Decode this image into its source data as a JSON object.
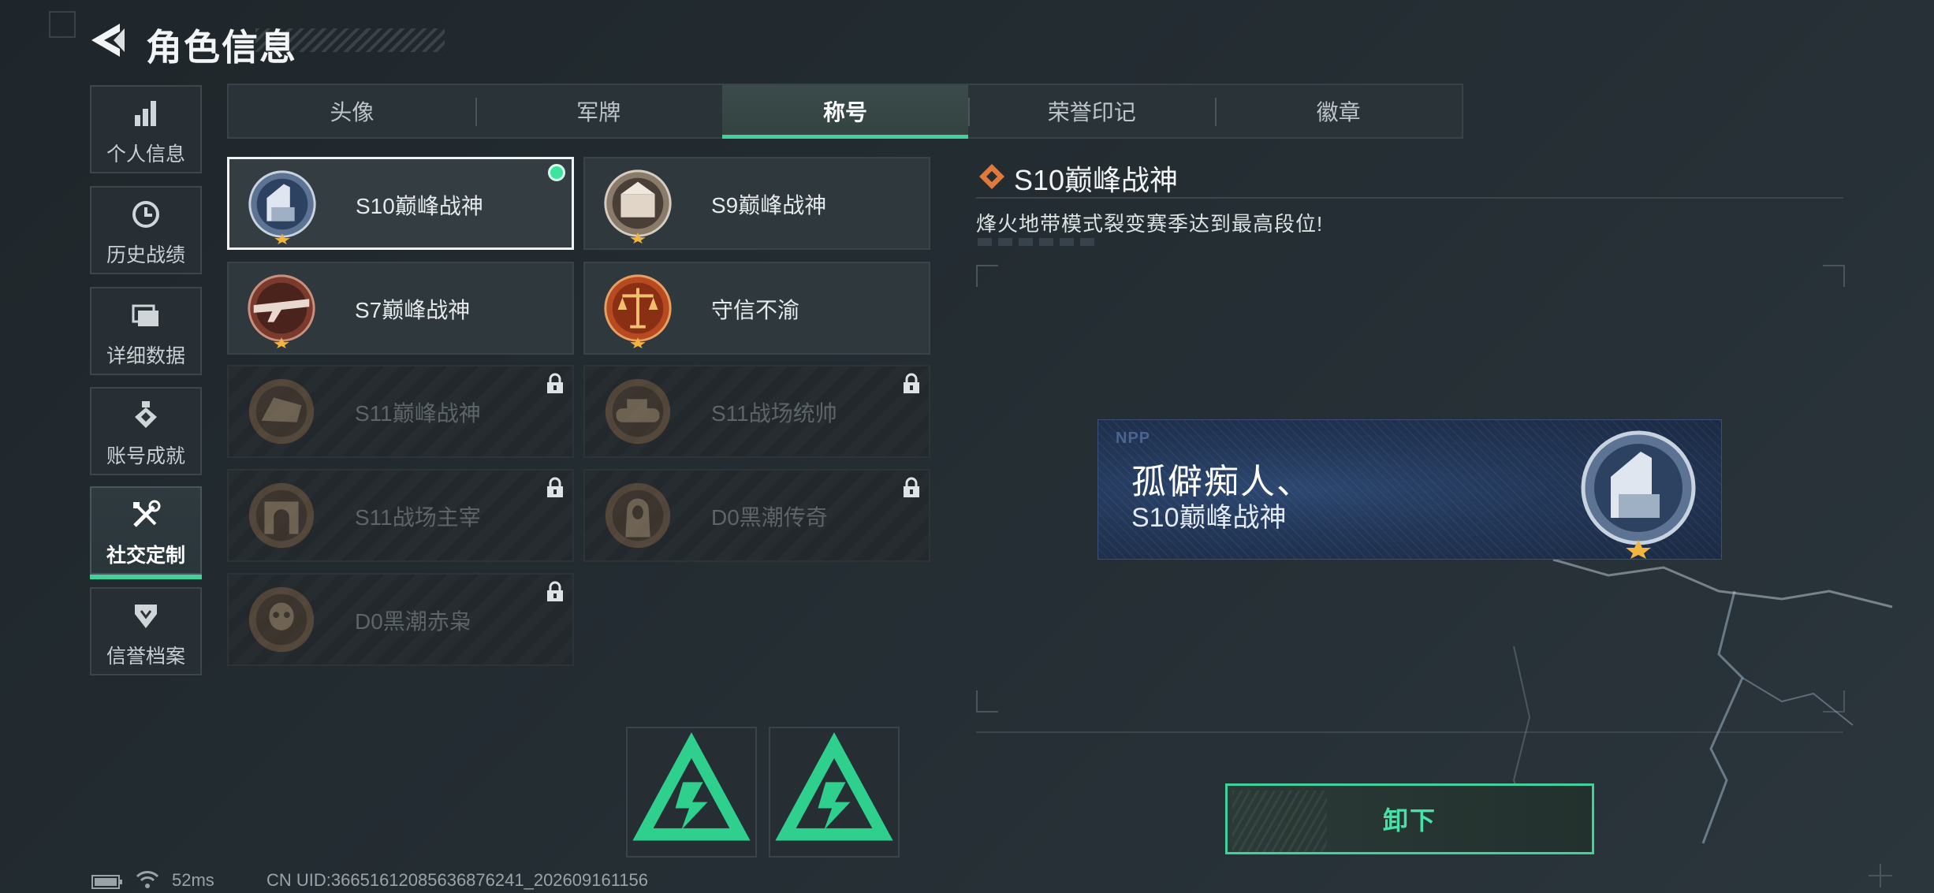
{
  "header": {
    "title": "角色信息"
  },
  "sidebar": {
    "items": [
      {
        "label": "个人信息",
        "icon": "bar-chart-icon"
      },
      {
        "label": "历史战绩",
        "icon": "history-clock-icon"
      },
      {
        "label": "详细数据",
        "icon": "folder-icon"
      },
      {
        "label": "账号成就",
        "icon": "achievement-medal-icon"
      },
      {
        "label": "社交定制",
        "icon": "tools-icon",
        "active": true
      },
      {
        "label": "信誉档案",
        "icon": "credit-shield-icon"
      }
    ]
  },
  "tabs": [
    {
      "label": "头像"
    },
    {
      "label": "军牌"
    },
    {
      "label": "称号",
      "active": true
    },
    {
      "label": "荣誉印记"
    },
    {
      "label": "徽章"
    }
  ],
  "titles": [
    {
      "name": "S10巅峰战神",
      "locked": false,
      "selected": true,
      "equipped": true,
      "badge": "s10-peak-badge-icon"
    },
    {
      "name": "S9巅峰战神",
      "locked": false,
      "badge": "s9-peak-badge-icon"
    },
    {
      "name": "S7巅峰战神",
      "locked": false,
      "badge": "s7-peak-badge-icon"
    },
    {
      "name": "守信不渝",
      "locked": false,
      "badge": "scales-badge-icon"
    },
    {
      "name": "S11巅峰战神",
      "locked": true,
      "badge": "s11-peak-badge-icon"
    },
    {
      "name": "S11战场统帅",
      "locked": true,
      "badge": "tank-badge-icon"
    },
    {
      "name": "S11战场主宰",
      "locked": true,
      "badge": "arch-badge-icon"
    },
    {
      "name": "D0黑潮传奇",
      "locked": true,
      "badge": "hooded-figure-badge-icon"
    },
    {
      "name": "D0黑潮赤枭",
      "locked": true,
      "badge": "skull-badge-icon"
    }
  ],
  "detail": {
    "title": "S10巅峰战神",
    "description": "烽火地带模式裂变赛季达到最高段位!"
  },
  "nameplate": {
    "logo": "NPP",
    "player_name": "孤僻痴人、",
    "title": "S10巅峰战神"
  },
  "actions": {
    "unequip_label": "卸下"
  },
  "status": {
    "ping": "52ms",
    "uid": "CN UID:366516120856368762​41_202609161156"
  },
  "colors": {
    "accent": "#3fd39b",
    "equipped_dot": "#3fe3a0",
    "nameplate_bg": "#223657"
  }
}
